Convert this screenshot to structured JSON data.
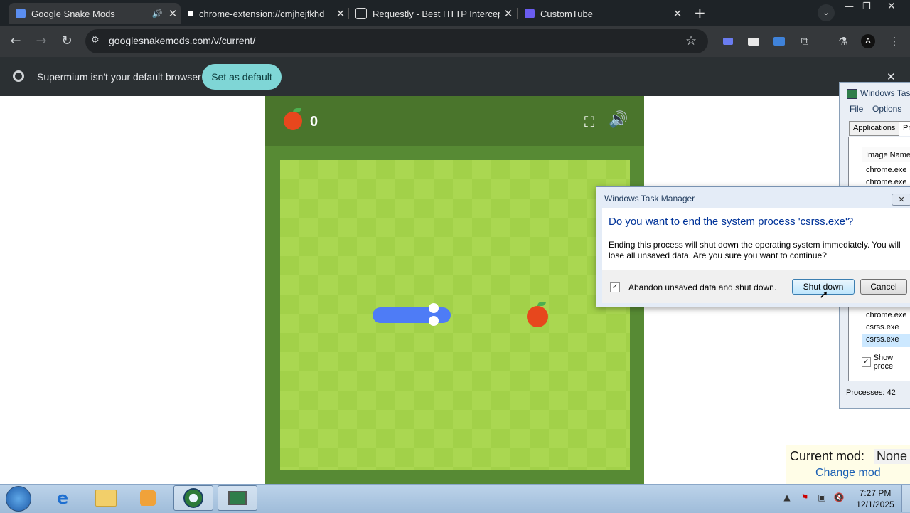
{
  "browser": {
    "tabs": [
      {
        "title": "Google Snake Mods",
        "active": true
      },
      {
        "title": "chrome-extension://cmjhejfkhd"
      },
      {
        "title": "Requestly - Best HTTP Intercept"
      },
      {
        "title": "CustomTube"
      }
    ],
    "url": "googlesnakemods.com/v/current/",
    "infobar": {
      "message": "Supermium isn't your default browser",
      "button": "Set as default"
    }
  },
  "game": {
    "score": "0"
  },
  "task_manager": {
    "title": "Windows Tas",
    "menu": [
      "File",
      "Options"
    ],
    "tabs": [
      "Applications",
      "Pr"
    ],
    "column_header": "Image Name",
    "rows_top": [
      "chrome.exe",
      "chrome.exe"
    ],
    "rows_bottom": [
      "chrome.exe",
      "csrss.exe",
      "csrss.exe"
    ],
    "show_processes": "Show proce",
    "status": "Processes: 42"
  },
  "dialog": {
    "title": "Windows Task Manager",
    "close": "✕",
    "heading": "Do you want to end the system process 'csrss.exe'?",
    "body": "Ending this process will shut down the operating system immediately.  You will lose all unsaved data.  Are you sure you want to continue?",
    "checkbox_label": "Abandon unsaved data and shut down.",
    "checkbox_checked": true,
    "shutdown_button": "Shut down",
    "cancel_button": "Cancel"
  },
  "mod_panel": {
    "label": "Current mod:",
    "value": "None",
    "link": "Change mod"
  },
  "taskbar": {
    "time": "7:27 PM",
    "date": "12/1/2025"
  },
  "colors": {
    "board_light": "#aad751",
    "board_dark": "#a2d149",
    "snake": "#4e7cf6",
    "apple": "#e7471d"
  }
}
